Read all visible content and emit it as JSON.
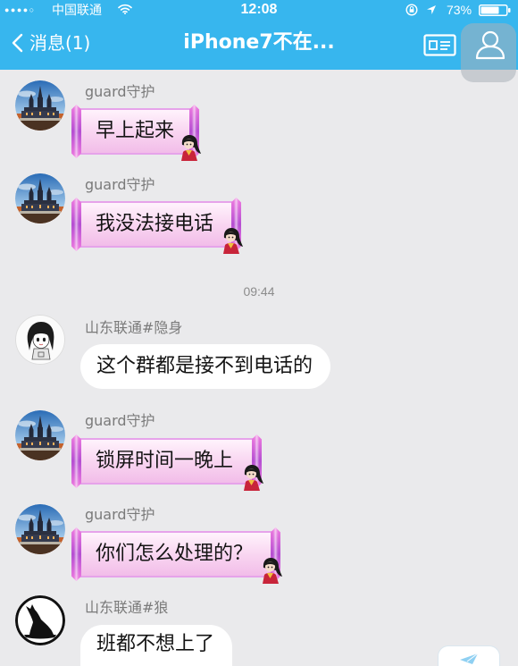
{
  "status_bar": {
    "signal": "●●●●○",
    "carrier": "中国联通",
    "time": "12:08",
    "battery": "73%",
    "icons": [
      "wifi-icon",
      "rotation-lock-icon",
      "location-arrow-icon",
      "battery-icon"
    ]
  },
  "nav": {
    "back_label": "消息(1)",
    "title": "iPhone7不在...",
    "icons": [
      "chevron-left-icon",
      "contact-card-icon",
      "profile-icon"
    ]
  },
  "chat": {
    "time_divider": "09:44",
    "messages": [
      {
        "sender": "guard守护",
        "text": "早上起来"
      },
      {
        "sender": "guard守护",
        "text": "我没法接电话"
      },
      {
        "sender": "山东联通#隐身",
        "text": "这个群都是接不到电话的"
      },
      {
        "sender": "guard守护",
        "text": "锁屏时间一晚上"
      },
      {
        "sender": "guard守护",
        "text": "你们怎么处理的？"
      },
      {
        "sender": "山东联通#狼",
        "text": "班都不想上了"
      }
    ]
  },
  "colors": {
    "nav_bar": "#37b6ee",
    "chat_background": "#eaeaec",
    "sender_name": "#7a7a7a",
    "timestamp": "#8c8c8c",
    "bubble_white": "#ffffff",
    "bubble_pink": "#f8d3f0",
    "bubble_ornament": "#b54fd2"
  }
}
